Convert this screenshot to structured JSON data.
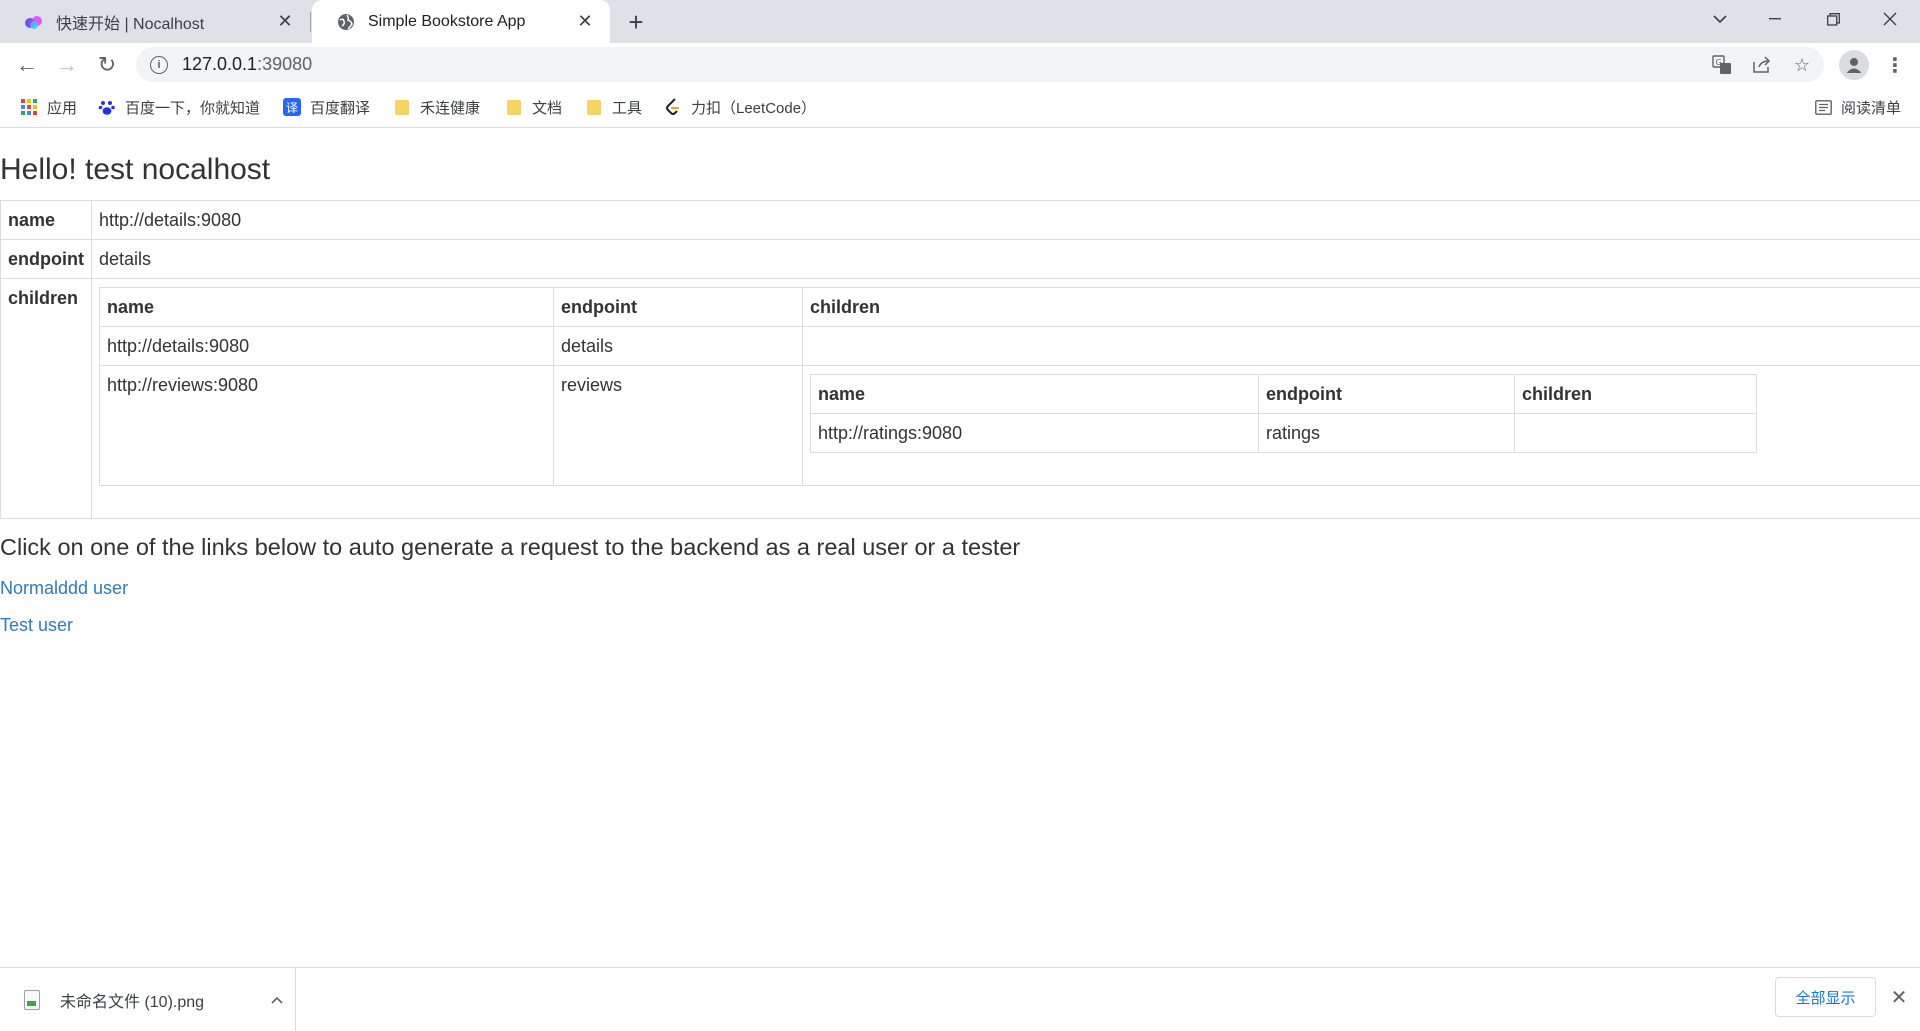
{
  "browser": {
    "tabs": [
      {
        "title": "快速开始 | Nocalhost",
        "active": false,
        "close": "✕"
      },
      {
        "title": "Simple Bookstore App",
        "active": true,
        "close": "✕"
      }
    ],
    "new_tab": "+",
    "window_controls": {
      "tab_search": "⌄",
      "minimize": "—",
      "restore": "❐",
      "close": "✕"
    },
    "nav": {
      "back": "←",
      "forward": "→",
      "reload": "↻"
    },
    "url_host": "127.0.0.1",
    "url_port": ":39080",
    "info_icon": "i",
    "omnibox_icons": {
      "translate": "⇄",
      "share": "⇪",
      "bookmark_star": "☆"
    },
    "menu": "⋮"
  },
  "bookmarks": [
    {
      "label": "应用",
      "icon": "apps-grid-icon"
    },
    {
      "label": "百度一下，你就知道",
      "icon": "baidu-paw-icon"
    },
    {
      "label": "百度翻译",
      "icon": "baidu-translate-icon",
      "glyph": "译"
    },
    {
      "label": "禾连健康",
      "icon": "folder-icon"
    },
    {
      "label": "文档",
      "icon": "folder-icon"
    },
    {
      "label": "工具",
      "icon": "folder-icon"
    },
    {
      "label": "力扣（LeetCode）",
      "icon": "leetcode-icon"
    }
  ],
  "reading_list": {
    "label": "阅读清单",
    "icon": "reading-list-icon"
  },
  "colors": {
    "link": "#337ab7",
    "tab_strip": "#dee1e6",
    "show_all_text": "#1a73e8"
  },
  "page": {
    "title": "Hello! test nocalhost",
    "service": {
      "name_key": "name",
      "name_value": "http://details:9080",
      "endpoint_key": "endpoint",
      "endpoint_value": "details",
      "children_key": "children",
      "children_table": {
        "headers": [
          "name",
          "endpoint",
          "children"
        ],
        "rows": [
          {
            "name": "http://details:9080",
            "endpoint": "details",
            "children": ""
          },
          {
            "name": "http://reviews:9080",
            "endpoint": "reviews",
            "children_table": {
              "headers": [
                "name",
                "endpoint",
                "children"
              ],
              "rows": [
                {
                  "name": "http://ratings:9080",
                  "endpoint": "ratings",
                  "children": ""
                }
              ]
            }
          }
        ]
      }
    },
    "instructions": "Click on one of the links below to auto generate a request to the backend as a real user or a tester",
    "links": [
      "Normalddd user",
      "Test user"
    ]
  },
  "downloads": {
    "file_name": "未命名文件 (10).png",
    "chevron": "⌃",
    "show_all": "全部显示",
    "close": "✕"
  }
}
